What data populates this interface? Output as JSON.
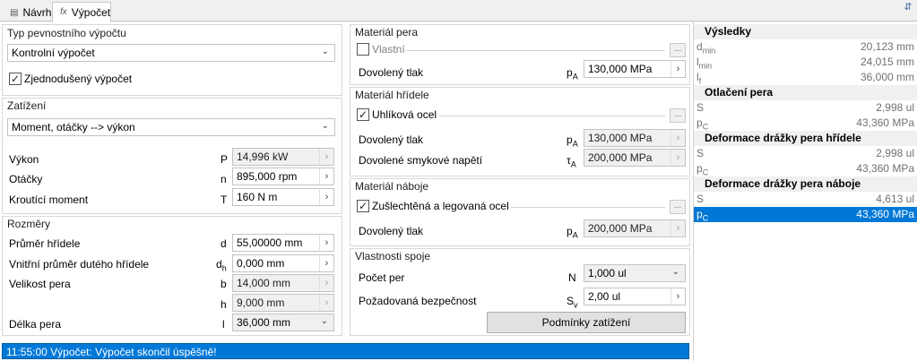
{
  "tabs": {
    "navrh": "Návrh",
    "vypocet": "Výpočet"
  },
  "typ": {
    "title": "Typ pevnostního výpočtu",
    "dropdown": "Kontrolní výpočet",
    "simplified": "Zjednodušený výpočet",
    "simplified_checked": true
  },
  "zatizeni": {
    "title": "Zatížení",
    "dropdown": "Moment, otáčky --> výkon",
    "rows": [
      {
        "label": "Výkon",
        "sym": "P",
        "value": "14,996 kW"
      },
      {
        "label": "Otáčky",
        "sym": "n",
        "value": "895,000 rpm"
      },
      {
        "label": "Kroutící moment",
        "sym": "T",
        "value": "160 N m"
      }
    ]
  },
  "rozmery": {
    "title": "Rozměry",
    "rows": [
      {
        "label": "Průměr hřídele",
        "sym": "d",
        "sub": "",
        "value": "55,00000 mm"
      },
      {
        "label": "Vnitřní průměr dutého hřídele",
        "sym": "d",
        "sub": "h",
        "value": "0,000 mm"
      },
      {
        "label": "Velikost pera",
        "sym": "b",
        "sub": "",
        "value": "14,000 mm"
      },
      {
        "label": "",
        "sym": "h",
        "sub": "",
        "value": "9,000 mm"
      },
      {
        "label": "Délka pera",
        "sym": "l",
        "sub": "",
        "value": "36,000 mm"
      }
    ]
  },
  "mat_pera": {
    "title": "Materiál pera",
    "check": "Vlastní",
    "checked": false,
    "row": {
      "label": "Dovolený tlak",
      "sym": "p",
      "sub": "A",
      "value": "130,000 MPa"
    }
  },
  "mat_hridele": {
    "title": "Materiál hřídele",
    "check": "Uhlíková ocel",
    "checked": true,
    "rows": [
      {
        "label": "Dovolený tlak",
        "sym": "p",
        "sub": "A",
        "value": "130,000 MPa"
      },
      {
        "label": "Dovolené smykové napětí",
        "sym": "τ",
        "sub": "A",
        "value": "200,000 MPa"
      }
    ]
  },
  "mat_naboje": {
    "title": "Materiál náboje",
    "check": "Zušlechtěná a legovaná ocel",
    "checked": true,
    "row": {
      "label": "Dovolený tlak",
      "sym": "p",
      "sub": "A",
      "value": "200,000 MPa"
    }
  },
  "spoj": {
    "title": "Vlastnosti spoje",
    "pocet": {
      "label": "Počet per",
      "sym": "N",
      "value": "1,000 ul"
    },
    "bezpecnost": {
      "label": "Požadovaná bezpečnost",
      "sym": "S",
      "sub": "v",
      "value": "2,00 ul"
    },
    "button": "Podmínky zatížení"
  },
  "results": {
    "sections": [
      {
        "title": "Výsledky",
        "rows": [
          {
            "sym": "d",
            "sub": "min",
            "value": "20,123 mm"
          },
          {
            "sym": "l",
            "sub": "min",
            "value": "24,015 mm"
          },
          {
            "sym": "l",
            "sub": "f",
            "value": "36,000 mm"
          }
        ]
      },
      {
        "title": "Otlačení pera",
        "rows": [
          {
            "sym": "S",
            "sub": "",
            "value": "2,998 ul"
          },
          {
            "sym": "p",
            "sub": "C",
            "value": "43,360 MPa"
          }
        ]
      },
      {
        "title": "Deformace drážky pera hřídele",
        "rows": [
          {
            "sym": "S",
            "sub": "",
            "value": "2,998 ul"
          },
          {
            "sym": "p",
            "sub": "C",
            "value": "43,360 MPa"
          }
        ]
      },
      {
        "title": "Deformace drážky pera náboje",
        "rows": [
          {
            "sym": "S",
            "sub": "",
            "value": "4,613 ul"
          },
          {
            "sym": "p",
            "sub": "C",
            "value": "43,360 MPa"
          }
        ]
      }
    ]
  },
  "status": "11:55:00 Výpočet: Výpočet skončil úspěšně!",
  "colors": {
    "selection": "#0078d7"
  }
}
